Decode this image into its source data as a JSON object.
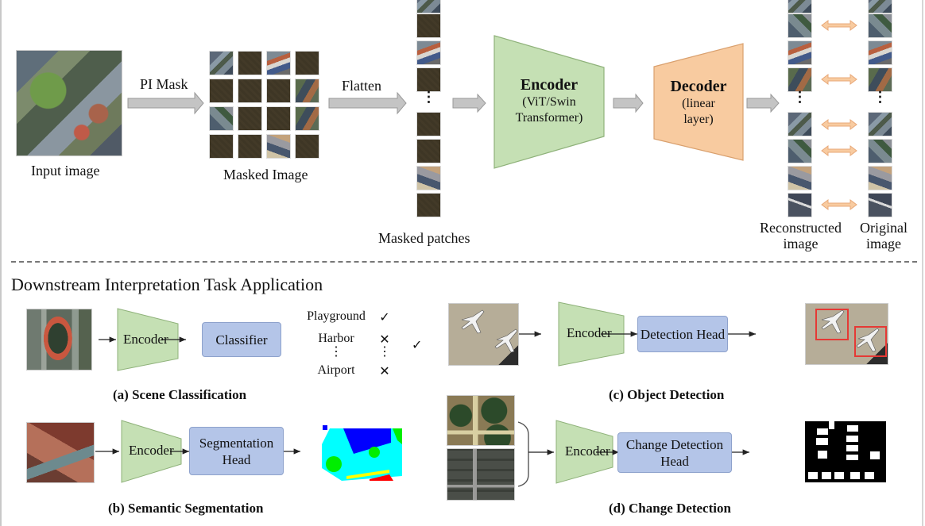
{
  "pretraining": {
    "input_image_label": "Input image",
    "mask_arrow_label": "PI Mask",
    "masked_image_label": "Masked Image",
    "flatten_arrow_label": "Flatten",
    "masked_patches_label": "Masked patches",
    "encoder": {
      "title": "Encoder",
      "subtitle_line1": "(ViT/Swin",
      "subtitle_line2": "Transformer)",
      "color": "#c5e0b4"
    },
    "decoder": {
      "title": "Decoder",
      "subtitle_line1": "(linear",
      "subtitle_line2": "layer)",
      "color": "#f8cba0"
    },
    "reconstructed_label_line1": "Reconstructed",
    "reconstructed_label_line2": "image",
    "original_label_line1": "Original",
    "original_label_line2": "image",
    "ellipsis": "⋮",
    "masked_grid": [
      "city1",
      "masked",
      "city2",
      "masked",
      "masked",
      "masked",
      "masked",
      "city3",
      "city4",
      "masked",
      "masked",
      "city3",
      "masked",
      "masked",
      "city5",
      "masked"
    ],
    "flattened_patches": [
      "city1",
      "masked",
      "city2",
      "masked",
      "masked",
      "masked",
      "city5",
      "masked"
    ],
    "reconstructed_patches": [
      "city4",
      "city2",
      "city3",
      "city1",
      "city4",
      "city5",
      "city6"
    ],
    "compare_arrow_rows": [
      0,
      2,
      3,
      4,
      6
    ]
  },
  "downstream": {
    "section_title": "Downstream Interpretation Task Application",
    "encoder_label": "Encoder",
    "scene_classification": {
      "caption": "(a) Scene Classification",
      "head_label": "Classifier",
      "classes": [
        {
          "name": "Playground",
          "mark": "✓"
        },
        {
          "name": "Harbor",
          "mark": "✕"
        },
        {
          "name": "⋮",
          "mark": "⋮"
        },
        {
          "name": "Airport",
          "mark": "✕"
        }
      ],
      "extra_mark": "✓"
    },
    "semantic_segmentation": {
      "caption": "(b) Semantic Segmentation",
      "head_label_line1": "Segmentation",
      "head_label_line2": "Head"
    },
    "object_detection": {
      "caption": "(c) Object Detection",
      "head_label": "Detection Head",
      "box_color": "#e53935"
    },
    "change_detection": {
      "caption": "(d) Change Detection",
      "head_label_line1": "Change Detection",
      "head_label_line2": "Head"
    },
    "colors": {
      "encoder": "#c5e0b4",
      "head": "#b4c5e8",
      "arrow_gray": "#c0c0c0",
      "compare_arrow": "#f4b183"
    }
  }
}
